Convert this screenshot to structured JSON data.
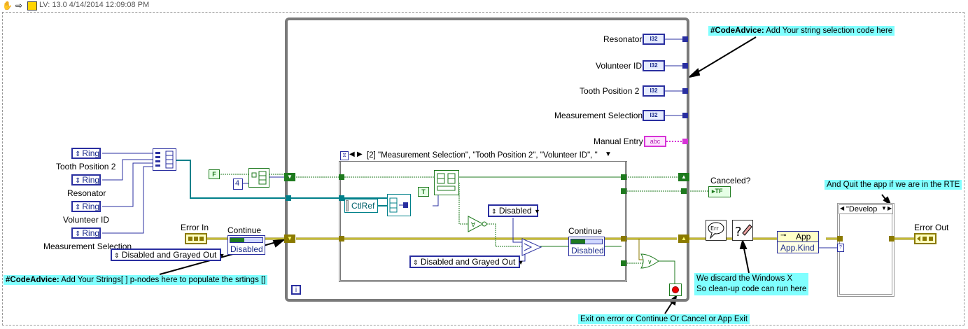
{
  "toolbar": {
    "version_text": "LV: 13.0 4/14/2014 12:09:08 PM"
  },
  "rings": [
    {
      "label": "Tooth Position 2",
      "value": "Ring"
    },
    {
      "label": "Resonator",
      "value": "Ring"
    },
    {
      "label": "Volunteer ID",
      "value": "Ring"
    },
    {
      "label": "Measurement Selection",
      "value": "Ring"
    }
  ],
  "indicators": [
    {
      "label": "Resonator",
      "type": "I32"
    },
    {
      "label": "Volunteer ID",
      "type": "I32"
    },
    {
      "label": "Tooth Position 2",
      "type": "I32"
    },
    {
      "label": "Measurement Selection",
      "type": "I32"
    },
    {
      "label": "Manual Entry",
      "type": "abc"
    }
  ],
  "constants": {
    "false_const": "F",
    "true_const": "T",
    "num_four": "4",
    "ctlref": "CtlRef",
    "disabled_enum": "Disabled",
    "disabled_grayed_inner": "Disabled and Grayed Out",
    "disabled_grayed_outer": "Disabled and Grayed Out",
    "develop_case": "\"Develop",
    "app_label": "App",
    "app_kind": "App.Kind"
  },
  "labels": {
    "error_in": "Error In",
    "continue_outer": "Continue",
    "continue_outer_state": "Disabled",
    "continue_inner": "Continue",
    "continue_inner_state": "Disabled",
    "canceled": "Canceled?",
    "error_out": "Error Out",
    "for_loop_selector": "[2] \"Measurement Selection\", \"Tooth Position 2\", \"Volunteer ID\", \"",
    "loop_index": "i"
  },
  "notes": {
    "top_tag": "#CodeAdvice:",
    "top_text": "Add Your string selection code here",
    "left_tag": "#CodeAdvice:",
    "left_text": "Add Your Strings[ ] p-nodes here to populate the srtings []",
    "quit_text": "And Quit the app if we are in the RTE",
    "discard_line1": "We discard the Windows X",
    "discard_line2": "So clean-up code can run here",
    "exit_text": "Exit on error or Continue Or Cancel or App Exit"
  },
  "colors": {
    "wire_int": "#2a2fa0",
    "wire_string": "#d633d6",
    "wire_bool": "#1e7a1e",
    "wire_error": "#8b7a00",
    "wire_ref": "#00808a",
    "note_bg": "#80ffff",
    "loop_border": "#777777"
  }
}
